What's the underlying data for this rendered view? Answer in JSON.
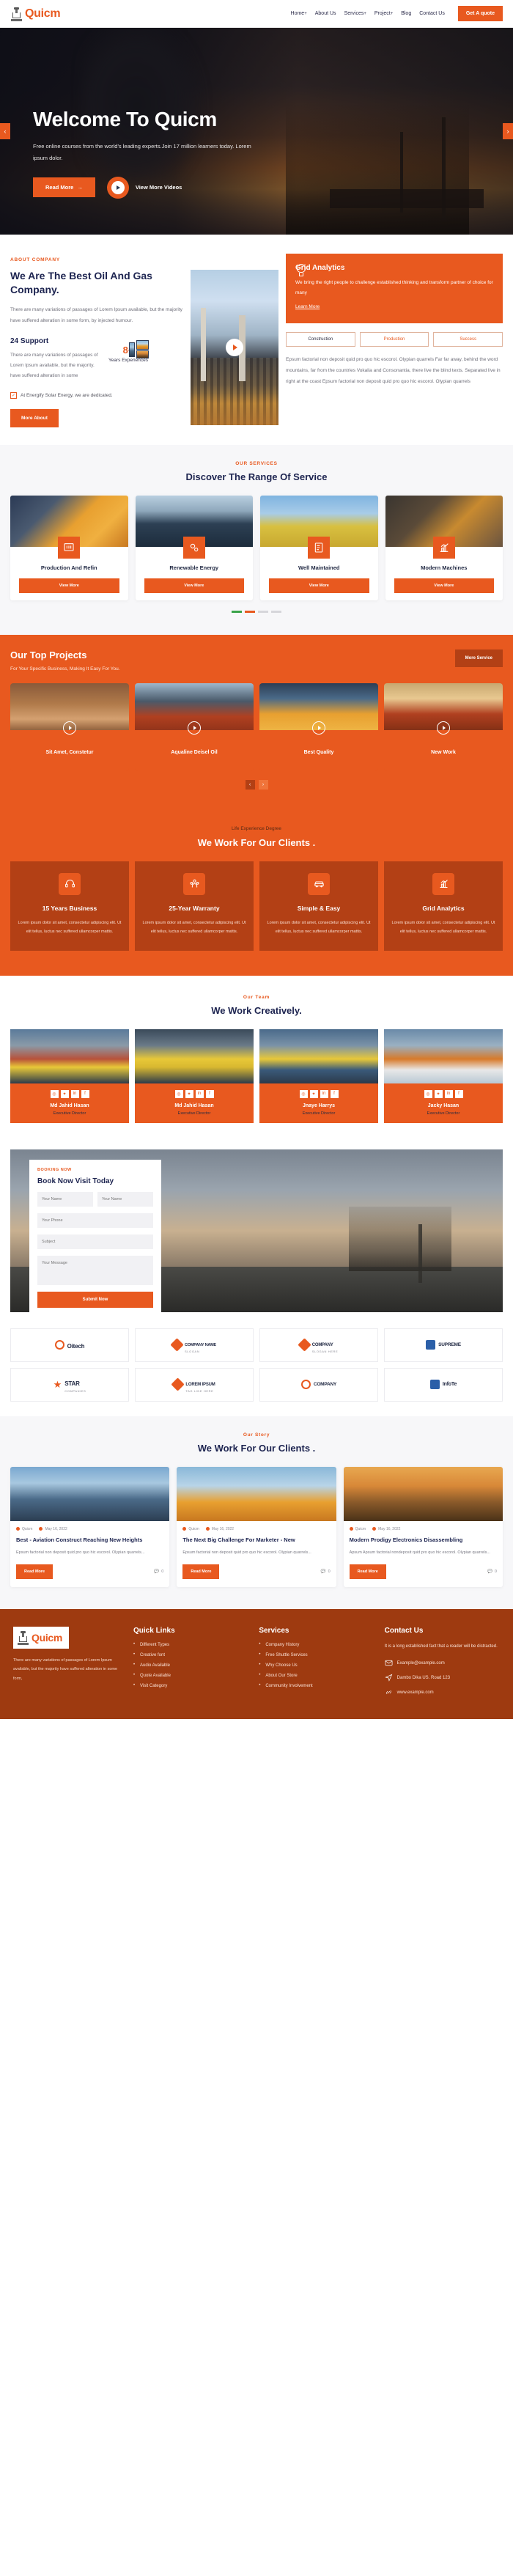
{
  "brand": {
    "name": "Quicm",
    "logo_icon": "oil-rig-icon"
  },
  "header": {
    "nav": [
      {
        "label": "Home",
        "caret": "+"
      },
      {
        "label": "About Us",
        "caret": ""
      },
      {
        "label": "Services",
        "caret": "+"
      },
      {
        "label": "Project",
        "caret": "+"
      },
      {
        "label": "Blog",
        "caret": ""
      },
      {
        "label": "Contact Us",
        "caret": ""
      }
    ],
    "quote_button": "Get A quote"
  },
  "hero": {
    "title": "Welcome To Quicm",
    "subtitle": "Free online courses from the world's leading experts.Join 17 million learners today. Lorem ipsum dolor.",
    "primary_button": "Read More",
    "primary_button_arrow": "→",
    "video_label": "View More Videos",
    "prev_arrow": "‹",
    "next_arrow": "›"
  },
  "about": {
    "eyebrow": "ABOUT COMPANY",
    "title": "We Are The Best Oil And Gas Company.",
    "lead": "There are many variations of passages of Lorem Ipsum available, but the majority have suffered alteration in some form, by injected humour.",
    "support_title": "24 Support",
    "support_text": "There are many variations of passages of Lorem Ipsum available, but the majority.  have suffered alteration in some",
    "experience_number": "8+",
    "experience_label": "Years Experiences",
    "check_text": "At Energify Solar Energy, we are dedicated.",
    "more_button": "More About",
    "card": {
      "icon": "lightbulb-icon",
      "title": "Grid Analytics",
      "text": "We bring the right people to challenge established thinking and transform partner of choice for many",
      "link": "Learn More"
    },
    "tabs": [
      "Construction",
      "Production",
      "Success"
    ],
    "body": "Epsum factorial non deposit quid pro quo hic escorol. Olypian quarrels Far far away, behind the word mountains, far from the countries Vokalia and Consonantia, there live the blind texts. Separated live in right at the coast Epsum factorial non deposit quid pro quo hic escorol. Olypian quarrels"
  },
  "services": {
    "eyebrow": "OUR SERVICES",
    "title": "Discover The Range Of Service",
    "items": [
      {
        "title": "Production And Refin",
        "button": "View More",
        "icon": "blueprint-icon"
      },
      {
        "title": "Renewable Energy",
        "button": "View More",
        "icon": "gears-icon"
      },
      {
        "title": "Well Maintained",
        "button": "View More",
        "icon": "document-chart-icon"
      },
      {
        "title": "Modern Machines",
        "button": "View More",
        "icon": "growth-chart-icon"
      }
    ]
  },
  "projects": {
    "title": "Our Top Projects",
    "subtitle": "For Your Specific Business, Making It Easy For You.",
    "button": "More Service",
    "items": [
      {
        "title": "Sit Amet, Constetur"
      },
      {
        "title": "Aqualine Deisel Oil"
      },
      {
        "title": "Best Quality"
      },
      {
        "title": "New Work"
      }
    ],
    "prev_arrow": "‹",
    "next_arrow": "›"
  },
  "clients": {
    "eyebrow": "Life Experience Degree",
    "title": "We Work For Our Clients .",
    "items": [
      {
        "title": "15 Years Business",
        "text": "Lorem ipsum dolor sit amet, consectetur adipiscing elit. Ut elit tellus, luctus nec suffered ullamcorper mattis.",
        "icon": "headset-icon"
      },
      {
        "title": "25-Year Warranty",
        "text": "Lorem ipsum dolor sit amet, consectetur adipiscing elit. Ut elit tellus, luctus nec suffered ullamcorper mattis.",
        "icon": "people-icon"
      },
      {
        "title": "Simple & Easy",
        "text": "Lorem ipsum dolor sit amet, consectetur adipiscing elit. Ut elit tellus, luctus nec suffered ullamcorper mattis.",
        "icon": "car-icon"
      },
      {
        "title": "Grid Analytics",
        "text": "Lorem ipsum dolor sit amet, consectetur adipiscing elit. Ut elit tellus, luctus nec suffered ullamcorper mattis.",
        "icon": "growth-chart-icon"
      }
    ]
  },
  "team": {
    "eyebrow": "Our Team",
    "title": "We Work Creatively.",
    "socials": [
      "◎",
      "✦",
      "in",
      "f"
    ],
    "members": [
      {
        "name": "Md Jahid Hasan",
        "role": "Executive Director"
      },
      {
        "name": "Md Jahid Hasan",
        "role": "Executive Director"
      },
      {
        "name": "Jnaye Harrys",
        "role": "Executive Director"
      },
      {
        "name": "Jacky Hasan",
        "role": "Executive Director"
      }
    ]
  },
  "booking": {
    "eyebrow": "BOOKING NOW",
    "title": "Book Now Visit Today",
    "fields": {
      "first_name": "Your Name",
      "last_name": "Your Name",
      "phone": "Your Phone",
      "subject": "Subject",
      "message": "Your Message"
    },
    "submit": "Submit Now"
  },
  "logos": {
    "row1": [
      {
        "name": "Oitech",
        "sub": "",
        "mark": "circle"
      },
      {
        "name": "COMPANY NAME",
        "sub": "SLOGAN",
        "mark": "diamond"
      },
      {
        "name": "COMPANY",
        "sub": "SLOGAN HERE",
        "mark": "x"
      },
      {
        "name": "SUPREME",
        "sub": "",
        "mark": "blue"
      }
    ],
    "row2": [
      {
        "name": "STAR",
        "sub": "COMPANIES",
        "mark": "star"
      },
      {
        "name": "LOREM IPSUM",
        "sub": "TAG LINE HERE",
        "mark": "diamond"
      },
      {
        "name": "COMPANY",
        "sub": "",
        "mark": "circle"
      },
      {
        "name": "InfoTe",
        "sub": "",
        "mark": "blue"
      }
    ]
  },
  "blog": {
    "eyebrow": "Our Story",
    "title": "We Work For Our Clients .",
    "posts": [
      {
        "author": "Quicm",
        "date": "May 16, 2022",
        "title": "Best - Aviation Construct Reaching New Heights",
        "excerpt": "Epsum factorial non deposit quid pro quo hic escorol. Olypian quarrels...",
        "button": "Read More",
        "comments": "0"
      },
      {
        "author": "Quicm",
        "date": "May 16, 2022",
        "title": "The Next Big Challenge For Marketer - New",
        "excerpt": "Epsum factorial non deposit quid pro quo hic escorol. Olypian quarrels...",
        "button": "Read More",
        "comments": "0"
      },
      {
        "author": "Quicm",
        "date": "May 16, 2022",
        "title": "Modern Prodigy Electronics Disassembling",
        "excerpt": "Apsum Apsum factorial nondeposit quid pro quo hic escorol. Olypian quarrels...",
        "button": "Read More",
        "comments": "0"
      }
    ]
  },
  "footer": {
    "about_text": "There are many variations of passages of Lorem Ipsum available, but the majority have suffered alteration in some form,",
    "quick_links_title": "Quick Links",
    "quick_links": [
      "Different Types",
      "Creative font",
      "Audio Available",
      "Quote Available",
      "Visit Category"
    ],
    "services_title": "Services",
    "services": [
      "Company History",
      "Free Shuttle Services",
      "Why Choose Us",
      "About Our Store",
      "Community Involvement"
    ],
    "contact_title": "Contact Us",
    "contact_text": "It is a long established fact that a reader will be distracted.",
    "contact_items": [
      {
        "icon": "envelope-icon",
        "value": "Example@example.com"
      },
      {
        "icon": "location-icon",
        "value": "Dambo Dika US. Road 123"
      },
      {
        "icon": "link-icon",
        "value": "www.example.com"
      }
    ]
  },
  "colors": {
    "accent": "#E8591F",
    "dark_accent": "#B34015",
    "footer_bg": "#9E3A10",
    "navy": "#1D2450"
  }
}
